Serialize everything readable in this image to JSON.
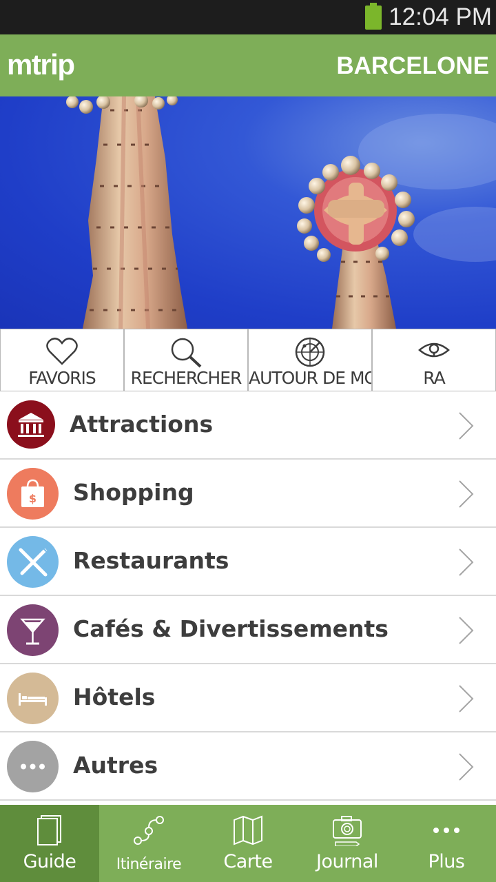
{
  "status_bar": {
    "time": "12:04 PM",
    "battery_color": "#7bb62b"
  },
  "app_bar": {
    "logo": "mtrip",
    "city": "BARCELONE",
    "color": "#7eae58"
  },
  "quick_actions": [
    {
      "label": "FAVORIS",
      "icon": "heart-icon"
    },
    {
      "label": "RECHERCHER",
      "icon": "search-icon"
    },
    {
      "label": "AUTOUR DE MOI",
      "icon": "radar-icon"
    },
    {
      "label": "RA",
      "icon": "eye-icon"
    }
  ],
  "categories": [
    {
      "label": "Attractions",
      "icon": "museum-icon",
      "color": "#8b0f1c"
    },
    {
      "label": "Shopping",
      "icon": "shopping-bag-icon",
      "color": "#ee7b5e"
    },
    {
      "label": "Restaurants",
      "icon": "cutlery-icon",
      "color": "#74b9e7"
    },
    {
      "label": "Cafés & Divertissements",
      "icon": "cocktail-icon",
      "color": "#7d4473"
    },
    {
      "label": "Hôtels",
      "icon": "bed-icon",
      "color": "#d4ba96"
    },
    {
      "label": "Autres",
      "icon": "more-dots-icon",
      "color": "#a3a3a3"
    }
  ],
  "bottom_nav": [
    {
      "label": "Guide",
      "icon": "book-icon",
      "active": true
    },
    {
      "label": "Itinéraire",
      "icon": "route-icon",
      "active": false
    },
    {
      "label": "Carte",
      "icon": "map-icon",
      "active": false
    },
    {
      "label": "Journal",
      "icon": "camera-icon",
      "active": false
    },
    {
      "label": "Plus",
      "icon": "more-dots-icon",
      "active": false
    }
  ]
}
